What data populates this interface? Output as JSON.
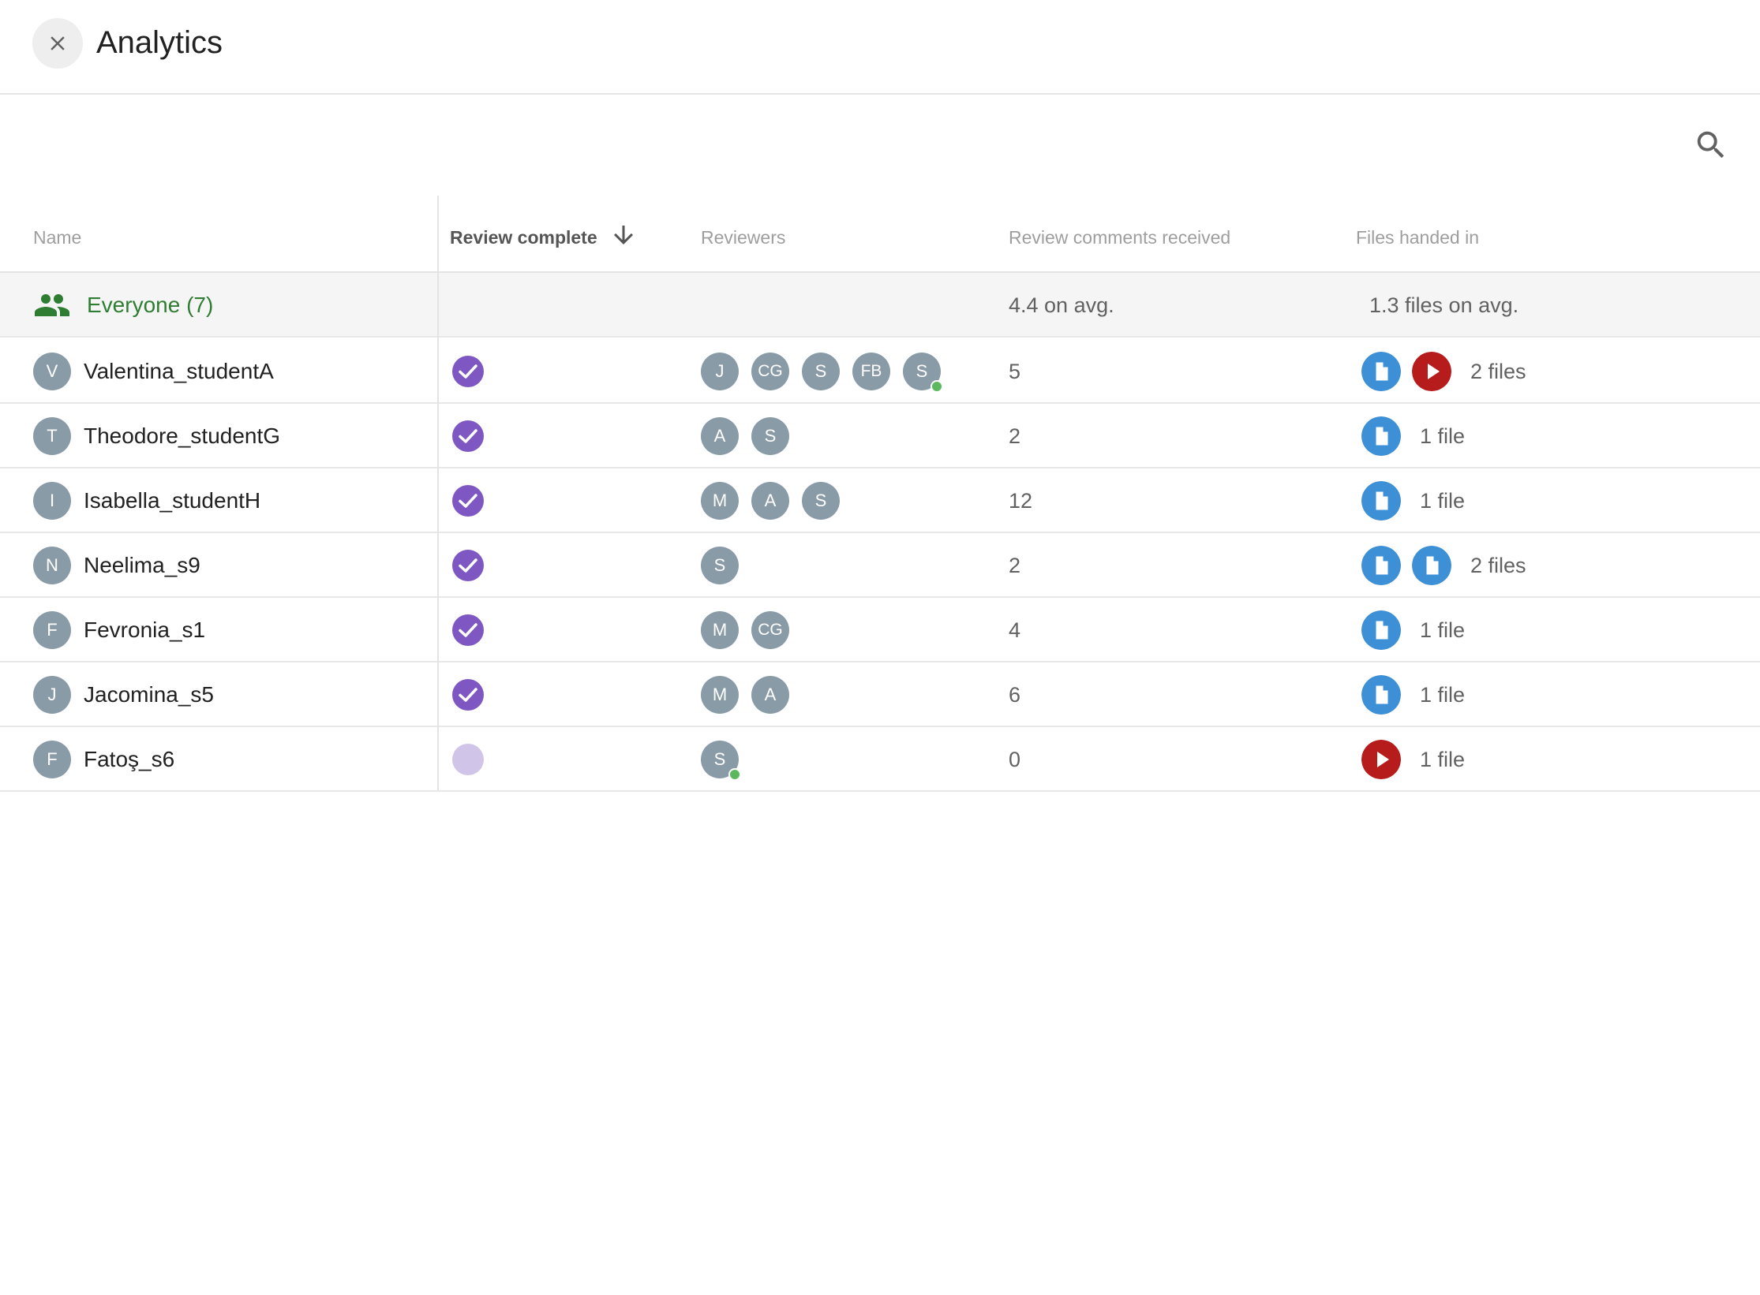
{
  "header": {
    "title": "Analytics"
  },
  "columns": {
    "name": "Name",
    "review_complete": "Review complete",
    "reviewers": "Reviewers",
    "comments": "Review comments received",
    "files": "Files handed in"
  },
  "summary": {
    "label": "Everyone (7)",
    "comments_avg": "4.4 on avg.",
    "files_avg": "1.3 files on avg."
  },
  "rows": [
    {
      "initial": "V",
      "name": "Valentina_studentA",
      "complete": true,
      "reviewers": [
        {
          "i": "J"
        },
        {
          "i": "CG"
        },
        {
          "i": "S"
        },
        {
          "i": "FB"
        },
        {
          "i": "S"
        }
      ],
      "comments": "5",
      "files_label": "2 files",
      "files": [
        "doc",
        "video"
      ]
    },
    {
      "initial": "T",
      "name": "Theodore_studentG",
      "complete": true,
      "reviewers": [
        {
          "i": "A"
        },
        {
          "i": "S"
        }
      ],
      "comments": "2",
      "files_label": "1 file",
      "files": [
        "doc"
      ]
    },
    {
      "initial": "I",
      "name": "Isabella_studentH",
      "complete": true,
      "reviewers": [
        {
          "i": "M"
        },
        {
          "i": "A"
        },
        {
          "i": "S"
        }
      ],
      "comments": "12",
      "files_label": "1 file",
      "files": [
        "doc"
      ]
    },
    {
      "initial": "N",
      "name": "Neelima_s9",
      "complete": true,
      "reviewers": [
        {
          "i": "S"
        }
      ],
      "comments": "2",
      "files_label": "2 files",
      "files": [
        "doc",
        "doc"
      ]
    },
    {
      "initial": "F",
      "name": "Fevronia_s1",
      "complete": true,
      "reviewers": [
        {
          "i": "M"
        },
        {
          "i": "CG"
        }
      ],
      "comments": "4",
      "files_label": "1 file",
      "files": [
        "doc"
      ]
    },
    {
      "initial": "J",
      "name": "Jacomina_s5",
      "complete": true,
      "reviewers": [
        {
          "i": "M"
        },
        {
          "i": "A"
        }
      ],
      "comments": "6",
      "files_label": "1 file",
      "files": [
        "doc"
      ]
    },
    {
      "initial": "F",
      "name": "Fatoş_s6",
      "complete": false,
      "reviewers": [
        {
          "i": "S"
        }
      ],
      "comments": "0",
      "files_label": "1 file",
      "files": [
        "video"
      ]
    }
  ],
  "reviewer_online": [
    [
      4
    ],
    [],
    [],
    [],
    [],
    [],
    [
      0
    ]
  ],
  "colors": {
    "complete": "#7e57c2",
    "incomplete": "#d1c4e9",
    "avatar": "#8a9ba8",
    "online": "#5cb85c",
    "doc": "#3d8fd6",
    "video": "#b71c1c",
    "everyone": "#2e7d32"
  },
  "icons": {
    "close": "close-icon",
    "search": "search-icon",
    "sort": "arrow-down-icon",
    "group": "group-icon",
    "complete": "check-circle-icon",
    "doc": "document-icon",
    "video": "play-icon"
  }
}
